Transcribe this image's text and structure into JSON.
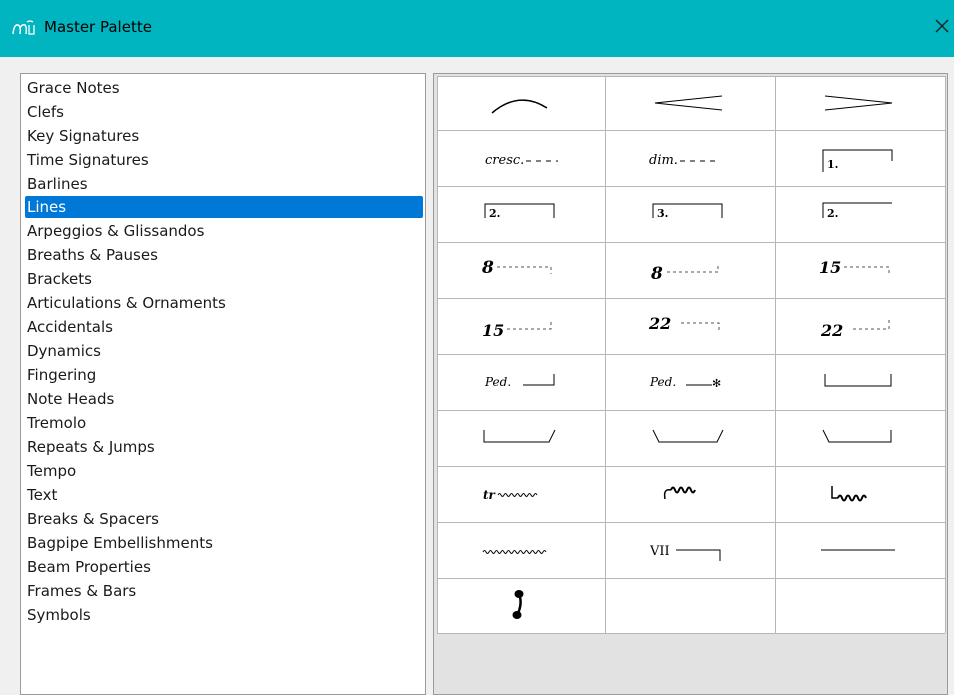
{
  "window": {
    "title": "Master Palette",
    "icon": "musescore-app-icon",
    "close_icon": "close-icon"
  },
  "categories": {
    "selected": "Lines",
    "items": [
      "Grace Notes",
      "Clefs",
      "Key Signatures",
      "Time Signatures",
      "Barlines",
      "Lines",
      "Arpeggios & Glissandos",
      "Breaths & Pauses",
      "Brackets",
      "Articulations & Ornaments",
      "Accidentals",
      "Dynamics",
      "Fingering",
      "Note Heads",
      "Tremolo",
      "Repeats & Jumps",
      "Tempo",
      "Text",
      "Breaks & Spacers",
      "Bagpipe Embellishments",
      "Beam Properties",
      "Frames & Bars",
      "Symbols"
    ]
  },
  "palette": {
    "cells": [
      {
        "name": "slur-icon",
        "text": ""
      },
      {
        "name": "crescendo-hairpin-icon",
        "text": ""
      },
      {
        "name": "diminuendo-hairpin-icon",
        "text": ""
      },
      {
        "name": "crescendo-line",
        "text": "cresc."
      },
      {
        "name": "diminuendo-line",
        "text": "dim."
      },
      {
        "name": "volta-1",
        "text": "1."
      },
      {
        "name": "volta-2-closed",
        "text": "2."
      },
      {
        "name": "volta-3",
        "text": "3."
      },
      {
        "name": "volta-2-open",
        "text": "2."
      },
      {
        "name": "ottava-8va",
        "text": "8"
      },
      {
        "name": "ottava-8vb",
        "text": "8"
      },
      {
        "name": "ottava-15ma",
        "text": "15"
      },
      {
        "name": "ottava-15mb",
        "text": "15"
      },
      {
        "name": "ottava-22ma",
        "text": "22"
      },
      {
        "name": "ottava-22mb",
        "text": "22"
      },
      {
        "name": "pedal-line",
        "text": "Ped."
      },
      {
        "name": "pedal-asterisk",
        "text": "Ped."
      },
      {
        "name": "pedal-bracket",
        "text": ""
      },
      {
        "name": "pedal-bracket-angled-end",
        "text": ""
      },
      {
        "name": "pedal-bracket-angled-both",
        "text": ""
      },
      {
        "name": "pedal-bracket-angled-start",
        "text": ""
      },
      {
        "name": "trill-line",
        "text": "tr"
      },
      {
        "name": "upprall-line",
        "text": ""
      },
      {
        "name": "downprall-line",
        "text": ""
      },
      {
        "name": "prallprall-line",
        "text": ""
      },
      {
        "name": "string-number-line",
        "text": "VII"
      },
      {
        "name": "plain-line",
        "text": ""
      },
      {
        "name": "fermata-staff-text-icon",
        "text": ""
      },
      {
        "name": "empty-cell",
        "text": ""
      },
      {
        "name": "empty-cell",
        "text": ""
      }
    ]
  }
}
